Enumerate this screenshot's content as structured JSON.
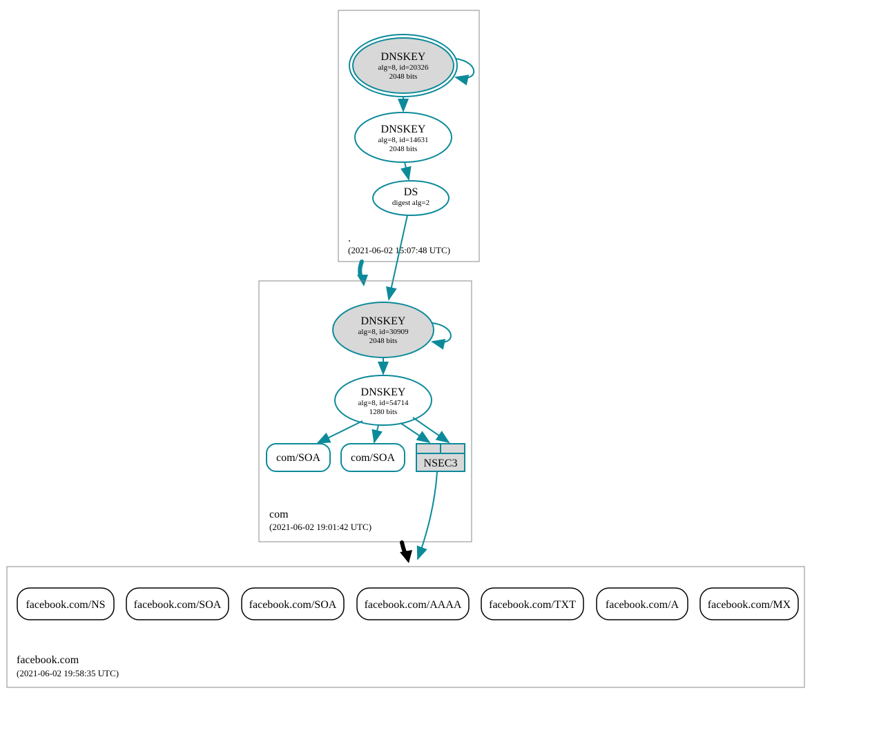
{
  "colors": {
    "teal": "#0c8a9a",
    "grey_fill": "#d8d8d8",
    "box_stroke": "#888888"
  },
  "zones": {
    "root": {
      "name": ".",
      "timestamp": "(2021-06-02 15:07:48 UTC)",
      "nodes": {
        "ksk": {
          "title": "DNSKEY",
          "line1": "alg=8, id=20326",
          "line2": "2048 bits"
        },
        "zsk": {
          "title": "DNSKEY",
          "line1": "alg=8, id=14631",
          "line2": "2048 bits"
        },
        "ds": {
          "title": "DS",
          "line1": "digest alg=2"
        }
      }
    },
    "com": {
      "name": "com",
      "timestamp": "(2021-06-02 19:01:42 UTC)",
      "nodes": {
        "ksk": {
          "title": "DNSKEY",
          "line1": "alg=8, id=30909",
          "line2": "2048 bits"
        },
        "zsk": {
          "title": "DNSKEY",
          "line1": "alg=8, id=54714",
          "line2": "1280 bits"
        },
        "soa1": "com/SOA",
        "soa2": "com/SOA",
        "nsec3": "NSEC3"
      }
    },
    "facebook": {
      "name": "facebook.com",
      "timestamp": "(2021-06-02 19:58:35 UTC)",
      "records": [
        "facebook.com/NS",
        "facebook.com/SOA",
        "facebook.com/SOA",
        "facebook.com/AAAA",
        "facebook.com/TXT",
        "facebook.com/A",
        "facebook.com/MX"
      ]
    }
  }
}
